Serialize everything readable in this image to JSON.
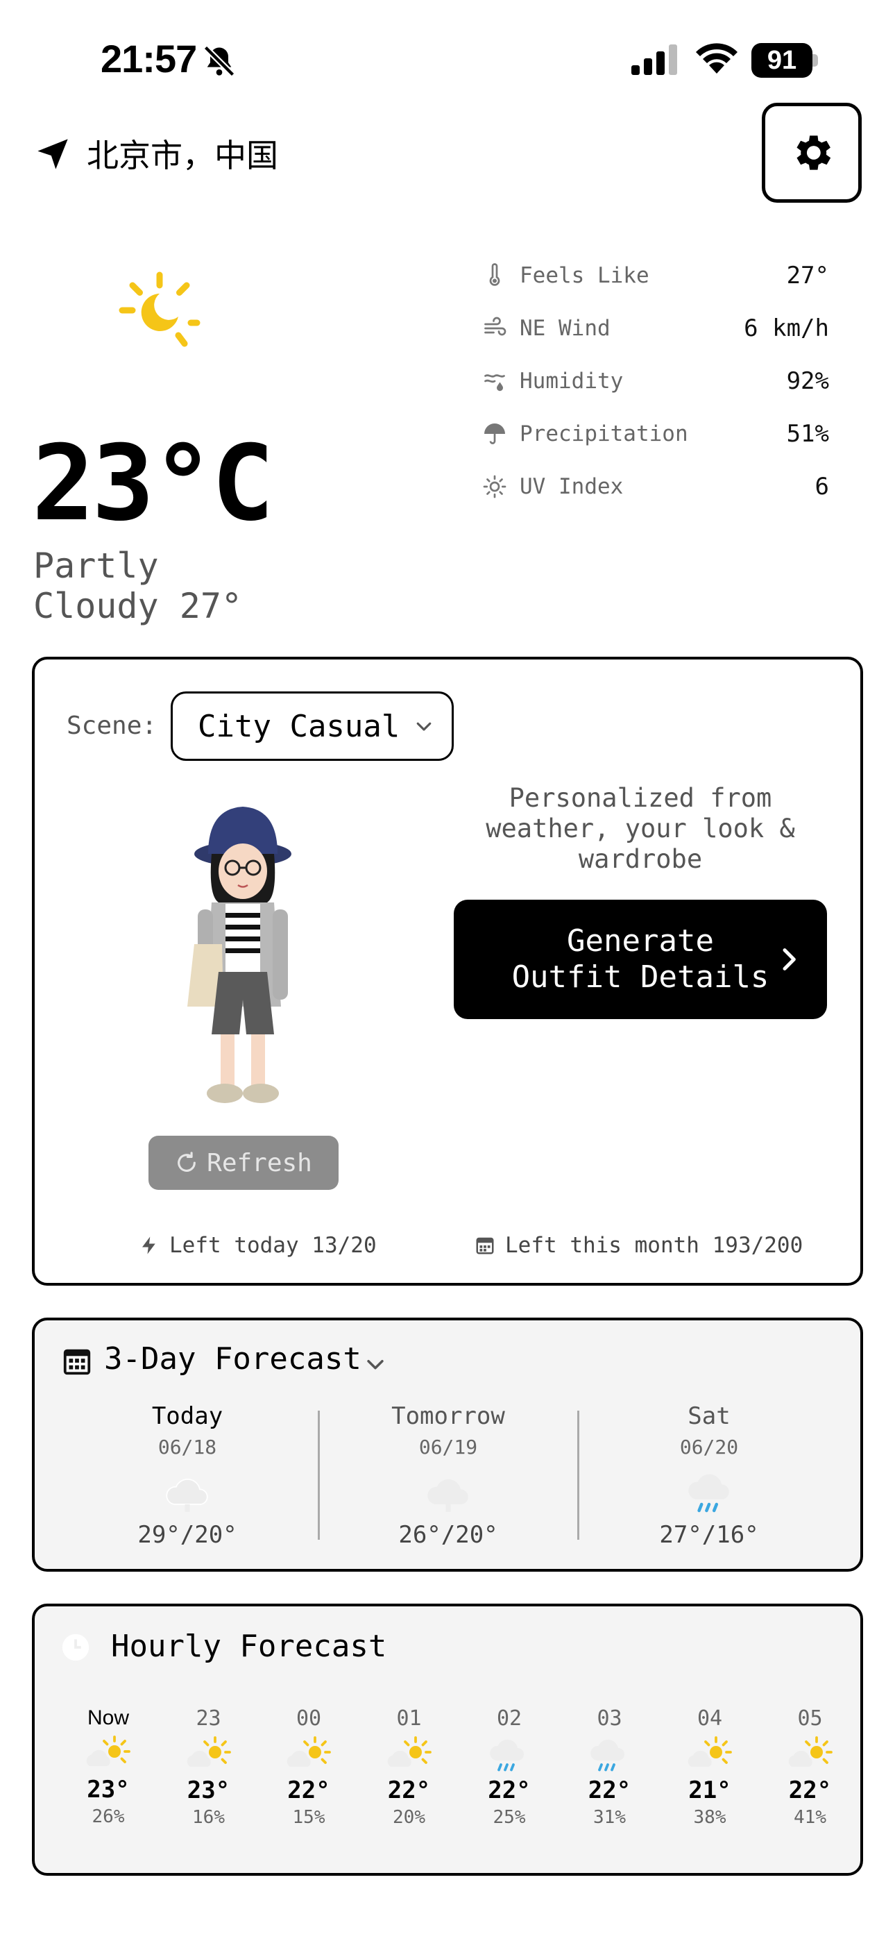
{
  "status_bar": {
    "time": "21:57",
    "battery": "91"
  },
  "location": {
    "text": "北京市，中国"
  },
  "current": {
    "temperature": "23°C",
    "condition": "Partly Cloudy 27°",
    "metrics": [
      {
        "icon": "thermometer-icon",
        "label": "Feels Like",
        "value": "27°"
      },
      {
        "icon": "wind-icon",
        "label": "NE Wind",
        "value": "6 km/h"
      },
      {
        "icon": "humidity-icon",
        "label": "Humidity",
        "value": "92%"
      },
      {
        "icon": "umbrella-icon",
        "label": "Precipitation",
        "value": "51%"
      },
      {
        "icon": "sun-outline-icon",
        "label": "UV Index",
        "value": "6"
      }
    ]
  },
  "outfit": {
    "scene_label": "Scene:",
    "scene_value": "City Casual",
    "personalized_text": "Personalized from weather, your look & wardrobe",
    "generate_button": "Generate Outfit Details",
    "refresh_button": "Refresh",
    "left_today": "Left today 13/20",
    "left_month": "Left this month 193/200"
  },
  "forecast": {
    "title": "3-Day Forecast",
    "days": [
      {
        "name": "Today",
        "date": "06/18",
        "icon": "cloud-icon",
        "range": "29°/20°"
      },
      {
        "name": "Tomorrow",
        "date": "06/19",
        "icon": "cloud-icon",
        "range": "26°/20°"
      },
      {
        "name": "Sat",
        "date": "06/20",
        "icon": "rain-cloud-icon",
        "range": "27°/16°"
      }
    ]
  },
  "hourly": {
    "title": "Hourly Forecast",
    "hours": [
      {
        "time": "Now",
        "icon": "partly-sunny-icon",
        "temp": "23°",
        "precip": "26%"
      },
      {
        "time": "23",
        "icon": "partly-sunny-icon",
        "temp": "23°",
        "precip": "16%"
      },
      {
        "time": "00",
        "icon": "partly-sunny-icon",
        "temp": "22°",
        "precip": "15%"
      },
      {
        "time": "01",
        "icon": "partly-sunny-icon",
        "temp": "22°",
        "precip": "20%"
      },
      {
        "time": "02",
        "icon": "rain-cloud-icon",
        "temp": "22°",
        "precip": "25%"
      },
      {
        "time": "03",
        "icon": "rain-cloud-icon",
        "temp": "22°",
        "precip": "31%"
      },
      {
        "time": "04",
        "icon": "partly-sunny-icon",
        "temp": "21°",
        "precip": "38%"
      },
      {
        "time": "05",
        "icon": "partly-sunny-icon",
        "temp": "22°",
        "precip": "41%"
      }
    ]
  },
  "colors": {
    "sun": "#F5C518",
    "rain": "#3BA7E0",
    "cloud": "#EDEDED"
  }
}
